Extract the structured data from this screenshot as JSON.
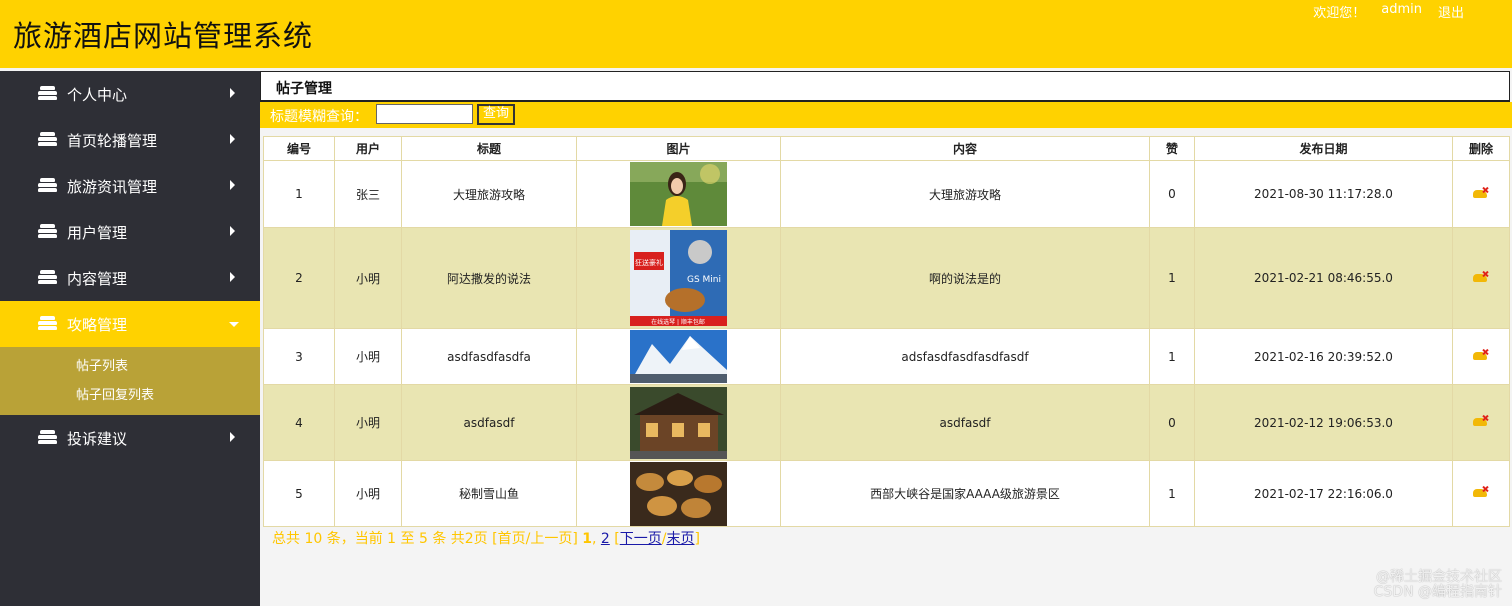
{
  "header": {
    "title": "旅游酒店网站管理系统",
    "welcome": "欢迎您！",
    "user": "admin",
    "logout": "退出"
  },
  "sidebar": {
    "items": [
      {
        "label": "个人中心"
      },
      {
        "label": "首页轮播管理"
      },
      {
        "label": "旅游资讯管理"
      },
      {
        "label": "用户管理"
      },
      {
        "label": "内容管理"
      },
      {
        "label": "攻略管理"
      },
      {
        "label": "投诉建议"
      }
    ],
    "submenu": [
      "帖子列表",
      "帖子回复列表"
    ]
  },
  "main": {
    "title": "帖子管理",
    "search_label": "标题模糊查询：",
    "search_value": "",
    "search_button": "查询"
  },
  "table": {
    "headers": [
      "编号",
      "用户",
      "标题",
      "图片",
      "内容",
      "赞",
      "发布日期",
      "删除"
    ],
    "rows": [
      {
        "id": "1",
        "user": "张三",
        "title": "大理旅游攻略",
        "content": "大理旅游攻略",
        "likes": "0",
        "date": "2021-08-30 11:17:28.0"
      },
      {
        "id": "2",
        "user": "小明",
        "title": "阿达撒发的说法",
        "content": "啊的说法是的",
        "likes": "1",
        "date": "2021-02-21 08:46:55.0"
      },
      {
        "id": "3",
        "user": "小明",
        "title": "asdfasdfasdfa",
        "content": "adsfasdfasdfasdfasdf",
        "likes": "1",
        "date": "2021-02-16 20:39:52.0"
      },
      {
        "id": "4",
        "user": "小明",
        "title": "asdfasdf",
        "content": "asdfasdf",
        "likes": "0",
        "date": "2021-02-12 19:06:53.0"
      },
      {
        "id": "5",
        "user": "小明",
        "title": "秘制雪山鱼",
        "content": "西部大峡谷是国家AAAA级旅游景区",
        "likes": "1",
        "date": "2021-02-17 22:16:06.0"
      }
    ],
    "images": [
      {
        "kind": "woman-portrait",
        "caption": ""
      },
      {
        "kind": "guitar-ad",
        "texts": [
          "GS Mini",
          "狂送豪礼",
          "在线选琴 | 顺丰包邮"
        ]
      },
      {
        "kind": "mountains",
        "caption": ""
      },
      {
        "kind": "wooden-house",
        "caption": ""
      },
      {
        "kind": "fish-dish",
        "caption": ""
      }
    ]
  },
  "pager": {
    "summary": "总共 10 条，当前 1 至 5 条 共2页",
    "first_prev": "[首页/上一页]",
    "page1": "1",
    "comma": ",",
    "page2": "2",
    "open": "[",
    "next": "下一页",
    "slash": "/",
    "last": "末页",
    "close": "]"
  },
  "watermark": "@稀土掘金技术社区\nCSDN @编程指南针"
}
